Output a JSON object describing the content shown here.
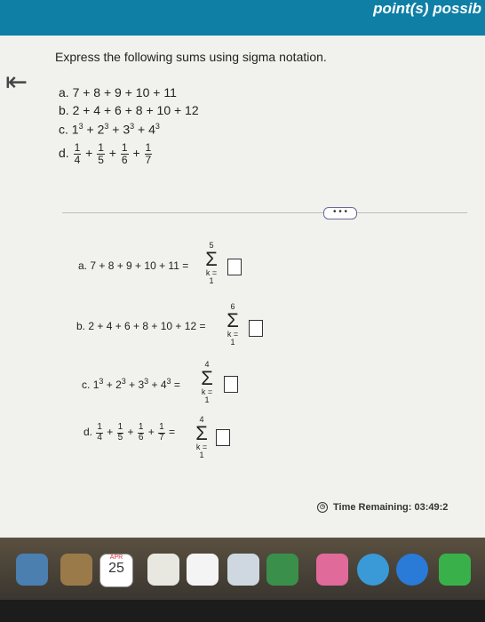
{
  "header": {
    "points_text": "point(s) possib"
  },
  "nav": {
    "back_glyph": "⇤"
  },
  "prompt": "Express the following sums using sigma notation.",
  "questions": {
    "a": "a. 7 + 8 + 9 + 10 + 11",
    "b": "b. 2 + 4 + 6 + 8 + 10 + 12",
    "c": {
      "label": "c.",
      "bases": [
        "1",
        "2",
        "3",
        "4"
      ],
      "exp": "3"
    },
    "d": {
      "label": "d.",
      "numerator": "1",
      "denominators": [
        "4",
        "5",
        "6",
        "7"
      ]
    }
  },
  "more_button": "• • •",
  "answers": {
    "a": {
      "lhs": "a. 7 + 8 + 9 + 10 + 11 =",
      "upper": "5",
      "lower": "k = 1",
      "sigma": "Σ"
    },
    "b": {
      "lhs": "b. 2 + 4 + 6 + 8 + 10 + 12 =",
      "upper": "6",
      "lower": "k = 1",
      "sigma": "Σ"
    },
    "c": {
      "label": "c.",
      "bases": [
        "1",
        "2",
        "3",
        "4"
      ],
      "exp": "3",
      "eq": "=",
      "upper": "4",
      "lower": "k = 1",
      "sigma": "Σ"
    },
    "d": {
      "label": "d.",
      "numerator": "1",
      "denominators": [
        "4",
        "5",
        "6",
        "7"
      ],
      "eq": "=",
      "upper": "4",
      "lower": "k = 1",
      "sigma": "Σ"
    }
  },
  "timer": {
    "label": "Time Remaining:",
    "value": "03:49:2"
  },
  "dock": {
    "calendar_day": "25",
    "calendar_month": "APR"
  }
}
